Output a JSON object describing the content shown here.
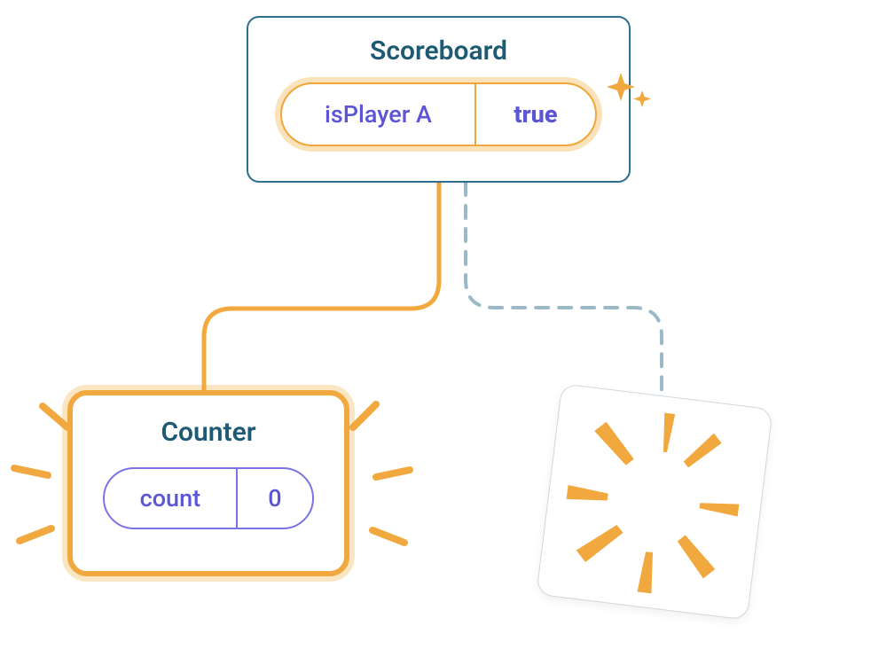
{
  "scoreboard": {
    "title": "Scoreboard",
    "state_label": "isPlayer A",
    "state_value": "true"
  },
  "counter": {
    "title": "Counter",
    "state_label": "count",
    "state_value": "0"
  },
  "colors": {
    "accent_orange": "#f1a83e",
    "accent_orange_soft": "rgba(242,171,58,0.35)",
    "label_teal": "#1f5a74",
    "purple": "#5c56d6",
    "dashed": "#9cb9c8"
  }
}
